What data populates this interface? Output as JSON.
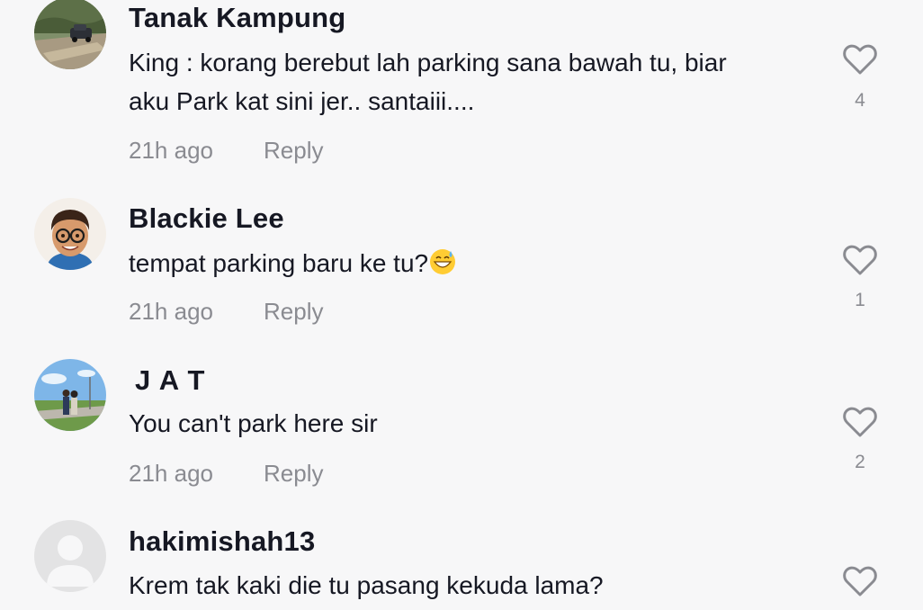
{
  "comments": [
    {
      "username": "Tanak Kampung",
      "lines": [
        "King : korang berebut lah parking sana bawah tu, biar",
        "aku Park kat sini jer.. santaiii...."
      ],
      "time": "21h ago",
      "reply": "Reply",
      "likes": "4",
      "avatar": "car-photo"
    },
    {
      "username": "Blackie Lee",
      "text": "tempat parking baru ke tu?",
      "emoji": "grinning-sweat-emoji",
      "time": "21h ago",
      "reply": "Reply",
      "likes": "1",
      "avatar": "cartoon-man-glasses"
    },
    {
      "username": "J A T",
      "text": "You can't park here sir",
      "time": "21h ago",
      "reply": "Reply",
      "likes": "2",
      "avatar": "couple-field-photo"
    },
    {
      "username": "hakimishah13",
      "text": "Krem tak kaki die tu pasang kekuda lama?",
      "avatar": "default-user"
    }
  ],
  "icons": {
    "like": "heart-outline-icon"
  },
  "colors": {
    "background": "#f7f7f8",
    "muted": "#8a8b91",
    "text": "#161823"
  }
}
